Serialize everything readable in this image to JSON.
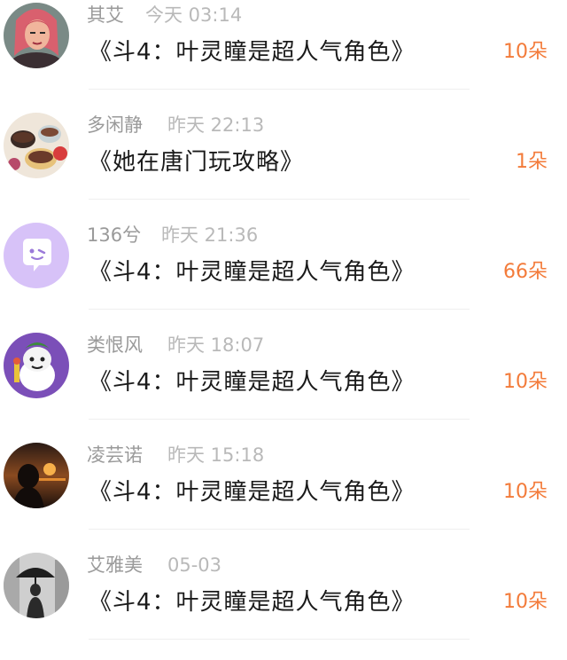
{
  "gift_list": {
    "items": [
      {
        "username": "其艾",
        "time": "今天 03:14",
        "book": "《斗4：叶灵瞳是超人气角色》",
        "gift": "10朵",
        "avatar_icon": "anime-woman-avatar-icon"
      },
      {
        "username": "多闲静",
        "time": "昨天 22:13",
        "book": "《她在唐门玩攻略》",
        "gift": "1朵",
        "avatar_icon": "teacups-avatar-icon"
      },
      {
        "username": "136兮",
        "time": "昨天 21:36",
        "book": "《斗4：叶灵瞳是超人气角色》",
        "gift": "66朵",
        "avatar_icon": "default-chat-avatar-icon"
      },
      {
        "username": "类恨风",
        "time": "昨天 18:07",
        "book": "《斗4：叶灵瞳是超人气角色》",
        "gift": "10朵",
        "avatar_icon": "cartoon-character-avatar-icon"
      },
      {
        "username": "凌芸诺",
        "time": "昨天 15:18",
        "book": "《斗4：叶灵瞳是超人气角色》",
        "gift": "10朵",
        "avatar_icon": "sunset-silhouette-avatar-icon"
      },
      {
        "username": "艾雅美",
        "time": "05-03",
        "book": "《斗4：叶灵瞳是超人气角色》",
        "gift": "10朵",
        "avatar_icon": "umbrella-figure-avatar-icon"
      }
    ]
  },
  "colors": {
    "gift_accent": "#f37b3a",
    "username": "#9a9a9a",
    "time": "#b9b9b9",
    "title": "#1a1a1a",
    "default_avatar_bg": "#d7c2f8"
  }
}
